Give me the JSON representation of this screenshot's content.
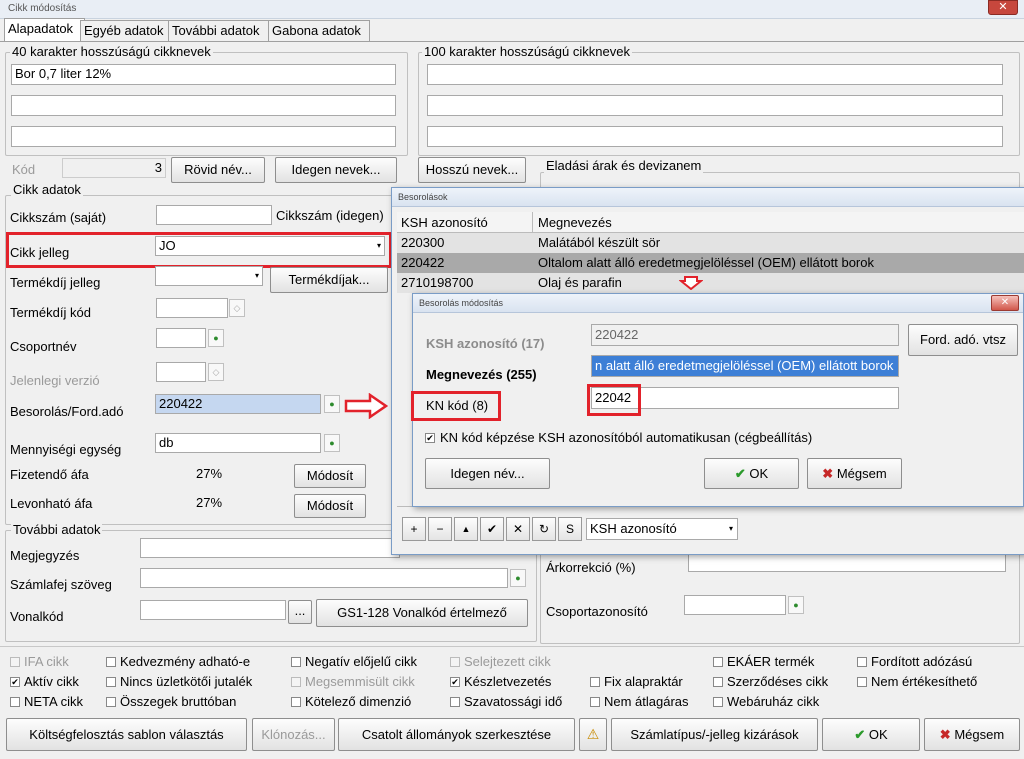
{
  "window": {
    "title": "Cikk módosítás",
    "close_glyph": "✕"
  },
  "tabs": [
    {
      "label": "Alapadatok"
    },
    {
      "label": "Egyéb adatok"
    },
    {
      "label": "További adatok"
    },
    {
      "label": "Gabona adatok"
    }
  ],
  "names40": {
    "label": "40 karakter hosszúságú cikknevek",
    "line1": "Bor 0,7 liter 12%",
    "line2": "",
    "line3": ""
  },
  "names100": {
    "label": "100 karakter hosszúságú cikknevek"
  },
  "kod": {
    "label": "Kód",
    "value": "3"
  },
  "buttons": {
    "rovid": "Rövid név...",
    "idegen": "Idegen nevek...",
    "hosszu": "Hosszú nevek...",
    "termekdijak": "Termékdíjak...",
    "modosit1": "Módosít",
    "modosit2": "Módosít",
    "gs1": "GS1-128 Vonalkód értelmező",
    "dots": "..."
  },
  "eladasi": {
    "label": "Eladási árak és devizanem"
  },
  "cikk_adatok": {
    "label": "Cikk adatok",
    "cikkszam_sajat": "Cikkszám (saját)",
    "cikkszam_idegen": "Cikkszám (idegen)",
    "cikk_jelleg": {
      "label": "Cikk jelleg",
      "value": "JO"
    },
    "termekdij_jelleg": "Termékdíj jelleg",
    "termekdij_kod": "Termékdíj kód",
    "csoportnev": "Csoportnév",
    "jelenlegi_verzio": "Jelenlegi verzió",
    "besorolas": {
      "label": "Besorolás/Ford.adó",
      "value": "220422"
    },
    "mennyisegi": {
      "label": "Mennyiségi egység",
      "value": "db"
    },
    "fizetendo": {
      "label": "Fizetendő áfa",
      "value": "27%"
    },
    "levonhato": {
      "label": "Levonható áfa",
      "value": "27%"
    }
  },
  "tovabbi": {
    "label": "További adatok",
    "megjegyzes": "Megjegyzés",
    "szamlafej": "Számlafej szöveg",
    "vonalkod": "Vonalkód"
  },
  "right_lower": {
    "arkorrekcio": "Árkorrekció (%)",
    "csoportazonosito": "Csoportazonosító"
  },
  "besorolasok": {
    "title": "Besorolások",
    "col1": "KSH azonosító",
    "col2": "Megnevezés",
    "rows": [
      {
        "id": "220300",
        "name": "Malátából készült sör"
      },
      {
        "id": "220422",
        "name": "Oltalom alatt álló eredetmegjelöléssel (OEM) ellátott borok"
      },
      {
        "id": "2710198700",
        "name": "Olaj és parafin"
      }
    ],
    "nav": [
      "+",
      "−",
      "▲",
      "✔",
      "✕",
      "↻",
      "S"
    ],
    "search_field": "KSH azonosító"
  },
  "modositas": {
    "title": "Besorolás módosítás",
    "ksh_label": "KSH azonosító (17)",
    "ksh_value": "220422",
    "ford_btn": "Ford. adó. vtsz",
    "megn_label": "Megnevezés (255)",
    "megn_value": "n alatt álló eredetmegjelöléssel (OEM) ellátott borok",
    "kn_label": "KN kód (8)",
    "kn_value": "22042",
    "check_label": "KN kód képzése KSH azonosítóból automatikusan (cégbeállítás)",
    "idegen_btn": "Idegen név...",
    "ok_btn": "OK",
    "megsem_btn": "Mégsem"
  },
  "checkboxes": [
    {
      "label": "IFA cikk",
      "checked": false,
      "disabled": true
    },
    {
      "label": "Kedvezmény adható-e",
      "checked": false,
      "disabled": false
    },
    {
      "label": "Negatív előjelű cikk",
      "checked": false,
      "disabled": false
    },
    {
      "label": "Selejtezett cikk",
      "checked": false,
      "disabled": true
    },
    {
      "label": "EKÁER termék",
      "checked": false,
      "disabled": false
    },
    {
      "label": "Fordított adózású",
      "checked": false,
      "disabled": false
    },
    {
      "label": "Aktív cikk",
      "checked": true,
      "disabled": false
    },
    {
      "label": "Nincs üzletkötői jutalék",
      "checked": false,
      "disabled": false
    },
    {
      "label": "Megsemmisült cikk",
      "checked": false,
      "disabled": true
    },
    {
      "label": "Készletvezetés",
      "checked": true,
      "disabled": false
    },
    {
      "label": "Fix alapraktár",
      "checked": false,
      "disabled": false
    },
    {
      "label": "Szerződéses cikk",
      "checked": false,
      "disabled": false
    },
    {
      "label": "Nem értékesíthető",
      "checked": false,
      "disabled": false
    },
    {
      "label": "NETA cikk",
      "checked": false,
      "disabled": false
    },
    {
      "label": "Összegek bruttóban",
      "checked": false,
      "disabled": false
    },
    {
      "label": "Kötelező dimenzió",
      "checked": false,
      "disabled": false
    },
    {
      "label": "Szavatossági idő",
      "checked": false,
      "disabled": false
    },
    {
      "label": "Nem átlagáras",
      "checked": false,
      "disabled": false
    },
    {
      "label": "Webáruház cikk",
      "checked": false,
      "disabled": false
    }
  ],
  "bottom": {
    "koltseg": "Költségfelosztás sablon választás",
    "klonozas": "Klónozás...",
    "csatolt": "Csatolt állományok szerkesztése",
    "szamlatipus": "Számlatípus/-jelleg kizárások",
    "ok": "OK",
    "megsem": "Mégsem"
  },
  "colors": {
    "highlight_red": "#e2222b",
    "selection_blue": "#3d7fd6",
    "field_blue": "#c5d7f0"
  }
}
